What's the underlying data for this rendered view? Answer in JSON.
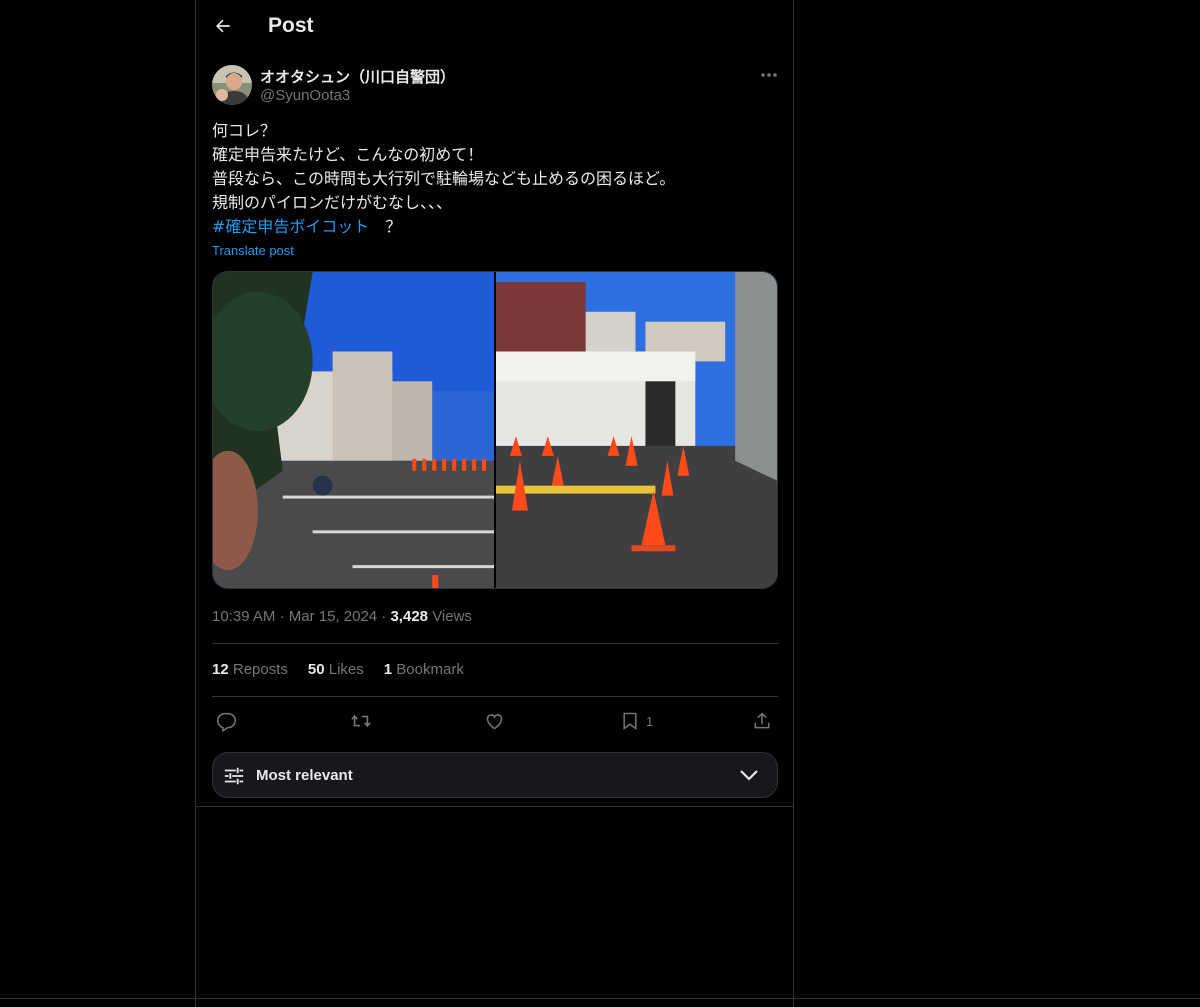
{
  "header": {
    "title": "Post",
    "back_icon": "arrow-left-icon"
  },
  "author": {
    "display_name": "オオタシュン（川口自警団）",
    "handle": "@SyunOota3"
  },
  "post": {
    "lines": [
      "何コレ？",
      "確定申告来たけど、こんなの初めて！",
      "普段なら、この時間も大行列で駐輪場なども止めるの困るほど。",
      "規制のパイロンだけがむなし、、、"
    ],
    "hashtag": "#確定申告ボイコット",
    "hashtag_suffix": "　？",
    "translate_label": "Translate post"
  },
  "meta": {
    "time": "10:39 AM",
    "dot1": "·",
    "date": "Mar 15, 2024",
    "dot2": "·",
    "views_count": "3,428",
    "views_label": "Views"
  },
  "stats": {
    "reposts_count": "12",
    "reposts_label": "Reposts",
    "likes_count": "50",
    "likes_label": "Likes",
    "bookmarks_count": "1",
    "bookmarks_label": "Bookmark"
  },
  "actions": {
    "bookmark_count": "1"
  },
  "sort": {
    "label": "Most relevant"
  },
  "colors": {
    "accent": "#1d9bf0",
    "muted": "#71767b",
    "text": "#e7e9ea",
    "border": "#2f3336"
  }
}
